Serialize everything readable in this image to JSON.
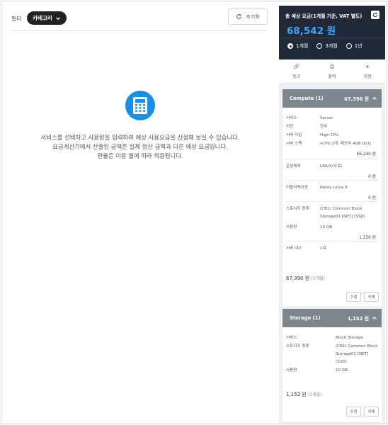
{
  "filter": {
    "label": "필터",
    "category_button": "카테고리",
    "reset_button": "초기화"
  },
  "empty_message": [
    "서비스를 선택하고 사용량을 입력하여 예상 사용요금을 산정해 보실 수 있습니다.",
    "요금계산기에서 산출된 금액은 실제 정산 금액과 다른 예상 요금입니다.",
    "환율은 이용 월에 따라 적용됩니다."
  ],
  "summary": {
    "title": "총 예상 요금(1개월 기준, VAT 별도)",
    "amount": "68,542 원",
    "periods": [
      {
        "label": "1개월",
        "selected": true
      },
      {
        "label": "3개월",
        "selected": false
      },
      {
        "label": "1년",
        "selected": false
      }
    ]
  },
  "actions": [
    {
      "icon": "link-icon",
      "glyph": "🔗",
      "label": "링크"
    },
    {
      "icon": "print-icon",
      "glyph": "⎙",
      "label": "출력"
    },
    {
      "icon": "excel-icon",
      "glyph": "x",
      "label": "저장"
    }
  ],
  "compute": {
    "header": {
      "name": "Compute (1)",
      "price": "67,390 원"
    },
    "fields": [
      {
        "k": "서비스",
        "v": "Server"
      },
      {
        "k": "리전",
        "v": "한국"
      },
      {
        "k": "서버 타입",
        "v": "High CPU"
      },
      {
        "k": "서버 스펙",
        "v": "vCPU 2개, 메모리 4GB [G3]"
      },
      {
        "k": "운영체제",
        "v": "LINUX(무료)"
      },
      {
        "k": "어플리케이션",
        "v": "Rocky Linux 8"
      },
      {
        "k": "스토리지 종류",
        "v": "(CB1) Common Block Storage01 [NET] (SSD)"
      },
      {
        "k": "사용량",
        "v": "10 GB"
      },
      {
        "k": "서버 대수",
        "v": "1대"
      }
    ],
    "subtotals": [
      "66,240 원",
      "0 원",
      "0 원",
      "1,150 원"
    ],
    "total": "67,390 원",
    "period": "(1개월)",
    "edit": "수정",
    "delete": "삭제"
  },
  "storage": {
    "header": {
      "name": "Storage (1)",
      "price": "1,152 원"
    },
    "fields": [
      {
        "k": "서비스",
        "v": "Block Storage"
      },
      {
        "k": "스토리지 종류",
        "v": "(CB1) Common Block Storage01 [NET] (SSD)"
      },
      {
        "k": "사용량",
        "v": "10 GB"
      }
    ],
    "total": "1,152 원",
    "period": "(1개월)",
    "edit": "수정",
    "delete": "삭제"
  },
  "colors": {
    "accent": "#1a8fe6",
    "summary_bg": "#1f2937",
    "amount": "#3ea6ff",
    "card_header": "#7d858f"
  }
}
